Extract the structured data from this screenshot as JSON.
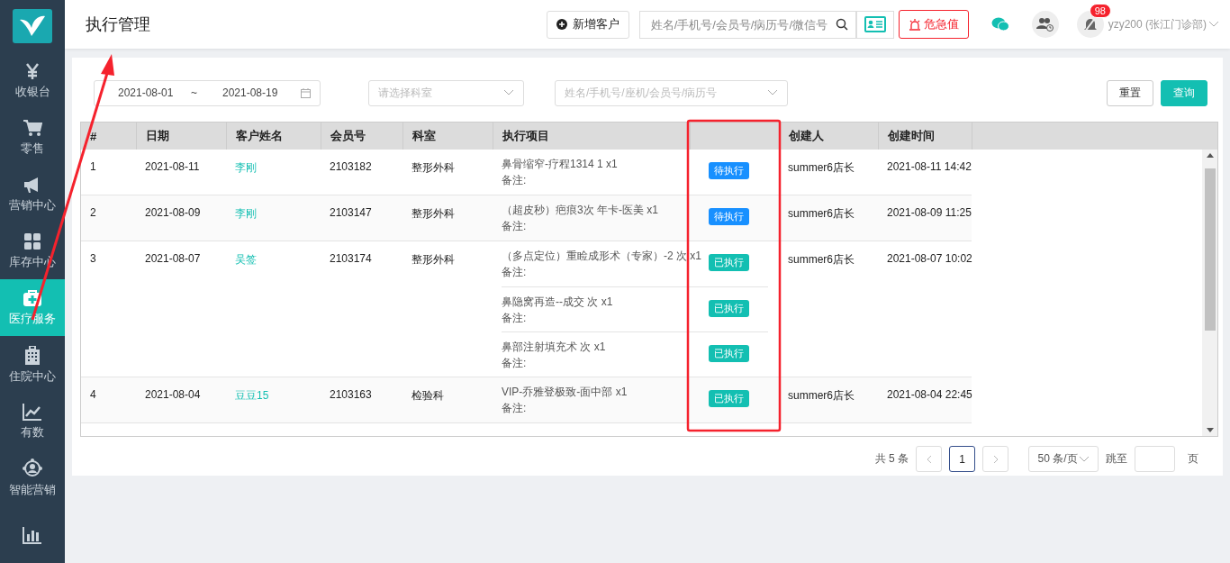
{
  "page_title": "执行管理",
  "header": {
    "add_button": "新增客户",
    "search": {
      "placeholder": "姓名/手机号/会员号/病历号/微信号"
    },
    "alert_button": "危急值",
    "notification_count": "98",
    "user": "yzy200 (张江门诊部)"
  },
  "sidebar": {
    "items": [
      {
        "label": "收银台",
        "kind": "yen",
        "selected": false
      },
      {
        "label": "零售",
        "kind": "cart",
        "selected": false
      },
      {
        "label": "营销中心",
        "kind": "megaphone",
        "selected": false
      },
      {
        "label": "库存中心",
        "kind": "grid",
        "selected": false
      },
      {
        "label": "医疗服务",
        "kind": "medkit",
        "selected": true
      },
      {
        "label": "住院中心",
        "kind": "hospital",
        "selected": false
      },
      {
        "label": "有数",
        "kind": "trend",
        "selected": false
      },
      {
        "label": "智能营销",
        "kind": "network",
        "selected": false
      },
      {
        "kind": "bars",
        "selected": false
      }
    ]
  },
  "filters": {
    "date_start": "2021-08-01",
    "date_separator": "~",
    "date_end": "2021-08-19",
    "department": {
      "placeholder": "请选择科室"
    },
    "customer": {
      "placeholder": "姓名/手机号/座机/会员号/病历号"
    },
    "buttons": [
      {
        "label": "重置",
        "kind": "default"
      },
      {
        "label": "查询",
        "kind": "primary"
      }
    ]
  },
  "table": {
    "columns": [
      "#",
      "日期",
      "客户姓名",
      "会员号",
      "科室",
      "执行项目",
      "创建人",
      "创建时间"
    ],
    "rows": [
      {
        "index": "1",
        "date": "2021-08-11",
        "customer": "李刚",
        "member_no": "2103182",
        "department": "整形外科",
        "items": [
          {
            "name": "鼻骨缩窄-疗程1314 1 x1",
            "note": "备注:",
            "status": "待执行",
            "kind": "pending"
          }
        ],
        "creator": "summer6店长",
        "created_at": "2021-08-11 14:42"
      },
      {
        "index": "2",
        "date": "2021-08-09",
        "customer": "李刚",
        "member_no": "2103147",
        "department": "整形外科",
        "items": [
          {
            "name": "（超皮秒）疤痕3次 年卡-医美 x1",
            "note": "备注:",
            "status": "待执行",
            "kind": "pending"
          }
        ],
        "creator": "summer6店长",
        "created_at": "2021-08-09 11:25"
      },
      {
        "index": "3",
        "date": "2021-08-07",
        "customer": "吴签",
        "member_no": "2103174",
        "department": "整形外科",
        "items": [
          {
            "name": "（多点定位）重睑成形术（专家）-2 次 x1",
            "note": "备注:",
            "status": "已执行",
            "kind": "done"
          },
          {
            "name": "鼻隐窝再造--成交 次 x1",
            "note": "备注:",
            "status": "已执行",
            "kind": "done"
          },
          {
            "name": "鼻部注射填充术 次 x1",
            "note": "备注:",
            "status": "已执行",
            "kind": "done"
          }
        ],
        "creator": "summer6店长",
        "created_at": "2021-08-07 10:02"
      },
      {
        "index": "4",
        "date": "2021-08-04",
        "customer": "豆豆15",
        "member_no": "2103163",
        "department": "检验科",
        "items": [
          {
            "name": "VIP-乔雅登极致-面中部 x1",
            "note": "备注:",
            "status": "已执行",
            "kind": "done"
          }
        ],
        "creator": "summer6店长",
        "created_at": "2021-08-04 22:45"
      }
    ]
  },
  "pagination": {
    "total": "共 5 条",
    "pages": [
      {
        "label": "1",
        "selected": true
      }
    ],
    "page_size": "50 条/页",
    "jump_label": "跳至",
    "page_unit": "页"
  }
}
